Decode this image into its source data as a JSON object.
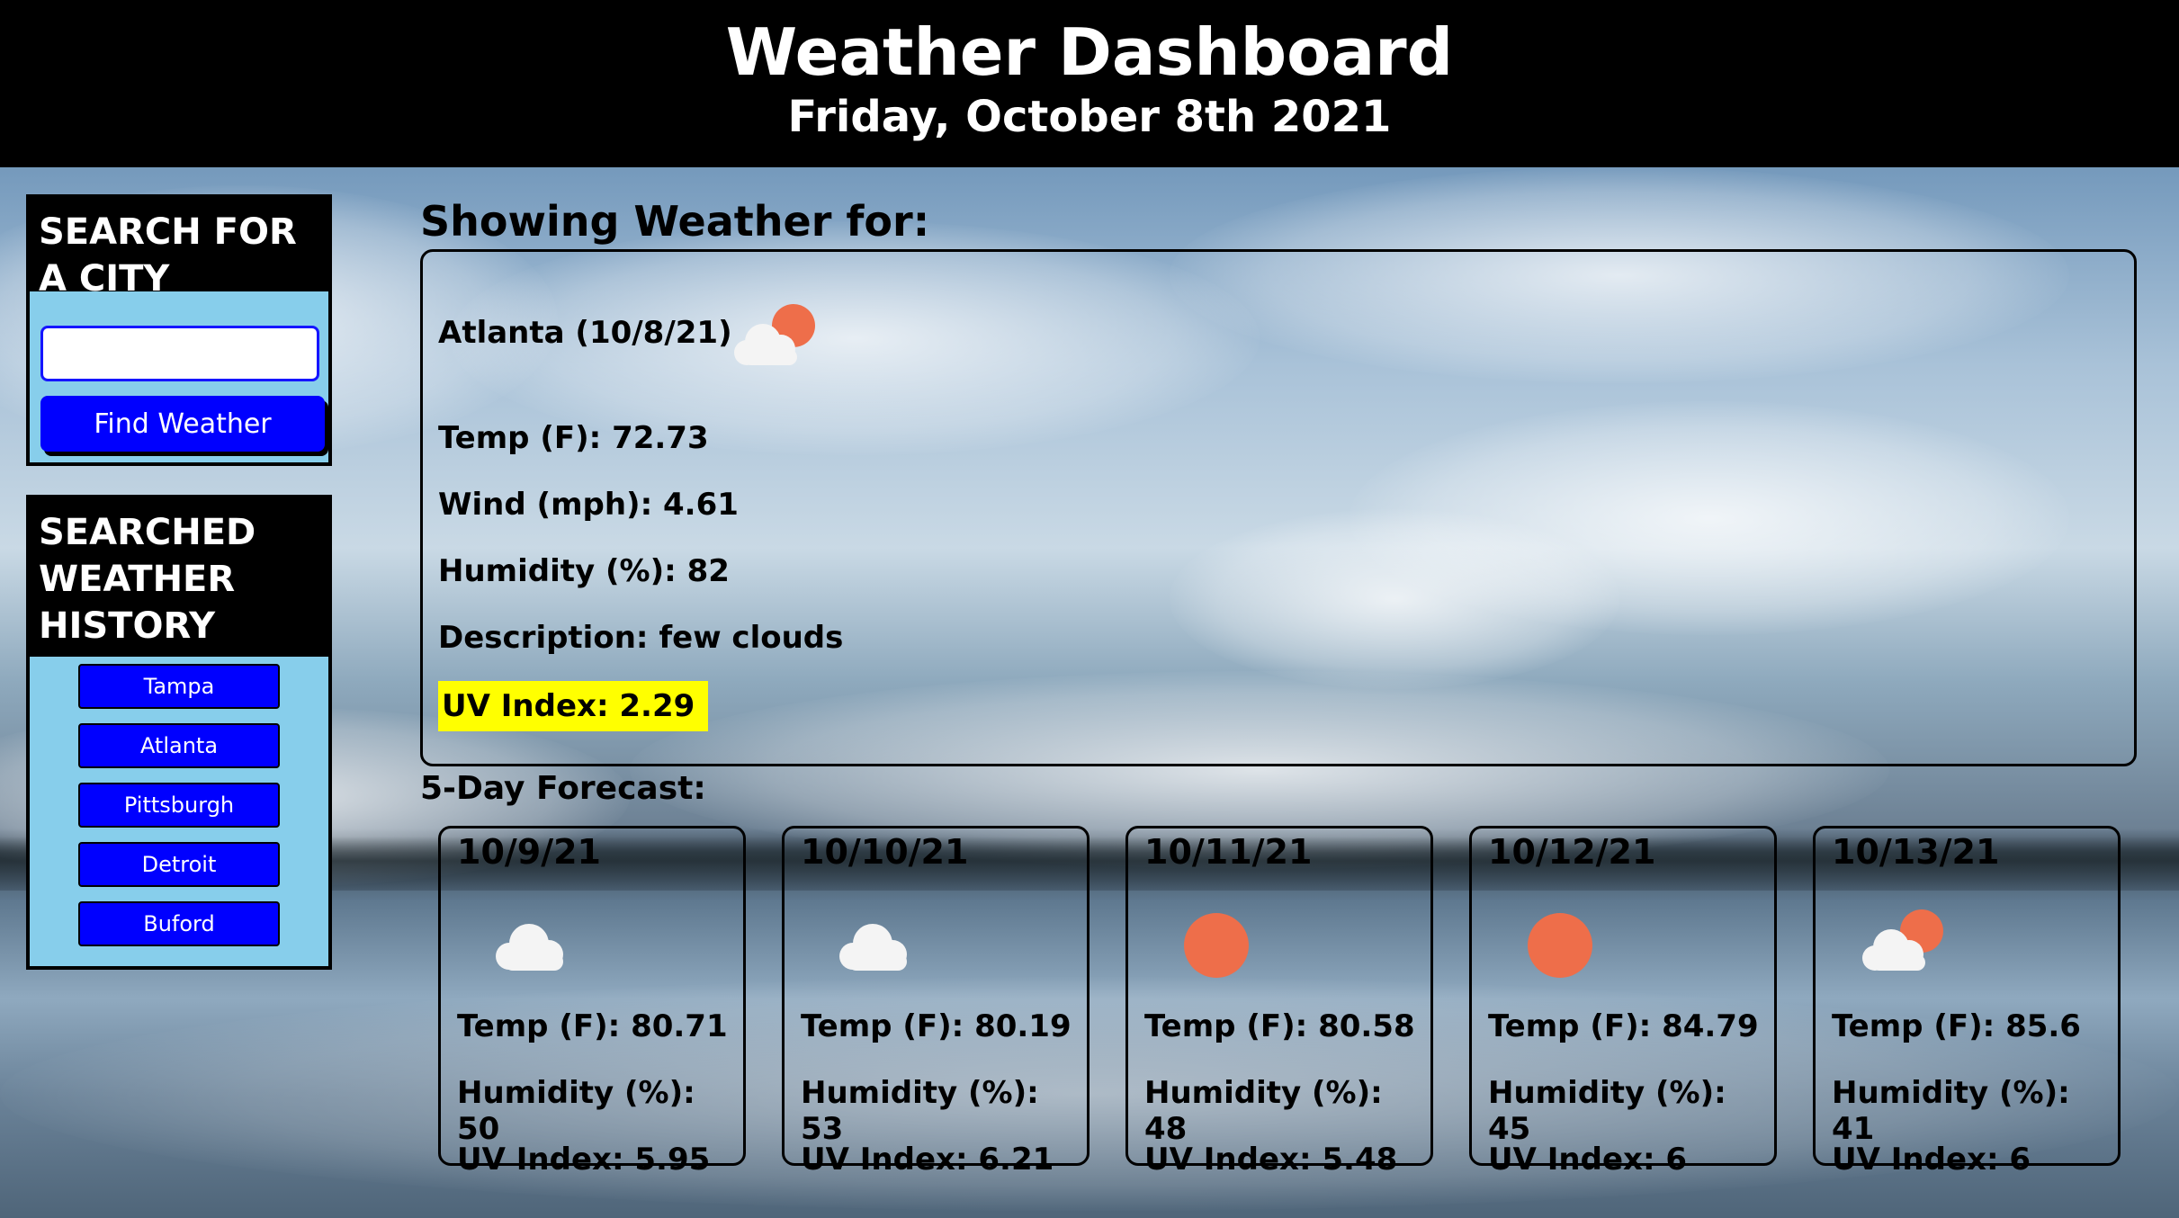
{
  "header": {
    "title": "Weather Dashboard",
    "date": "Friday, October 8th 2021"
  },
  "search": {
    "heading": "SEARCH FOR A CITY",
    "input_value": "",
    "placeholder": "",
    "button_label": "Find Weather"
  },
  "history": {
    "heading": "SEARCHED WEATHER HISTORY",
    "items": [
      "Tampa",
      "Atlanta",
      "Pittsburgh",
      "Detroit",
      "Buford"
    ]
  },
  "current": {
    "section_title": "Showing Weather for:",
    "city_date": "Atlanta (10/8/21)",
    "icon": "partly-cloudy-icon",
    "temp": "Temp (F): 72.73",
    "wind": "Wind (mph): 4.61",
    "humidity": "Humidity (%): 82",
    "description": "Description: few clouds",
    "uv": "UV Index: 2.29",
    "uv_color": "#ffff00"
  },
  "forecast": {
    "title": "5-Day Forecast:",
    "days": [
      {
        "date": "10/9/21",
        "icon": "cloud-icon",
        "temp": "Temp (F): 80.71",
        "humidity": "Humidity (%): 50",
        "uv": "UV Index: 5.95"
      },
      {
        "date": "10/10/21",
        "icon": "cloud-icon",
        "temp": "Temp (F): 80.19",
        "humidity": "Humidity (%): 53",
        "uv": "UV Index: 6.21"
      },
      {
        "date": "10/11/21",
        "icon": "sun-icon",
        "temp": "Temp (F): 80.58",
        "humidity": "Humidity (%): 48",
        "uv": "UV Index: 5.48"
      },
      {
        "date": "10/12/21",
        "icon": "sun-icon",
        "temp": "Temp (F): 84.79",
        "humidity": "Humidity (%): 45",
        "uv": "UV Index: 6"
      },
      {
        "date": "10/13/21",
        "icon": "partly-cloudy-icon",
        "temp": "Temp (F): 85.6",
        "humidity": "Humidity (%): 41",
        "uv": "UV Index: 6"
      }
    ]
  },
  "colors": {
    "header_bg": "#000000",
    "button_blue": "#0000ff",
    "panel_bg": "#87ceeb",
    "sun": "#ee6e4a"
  }
}
